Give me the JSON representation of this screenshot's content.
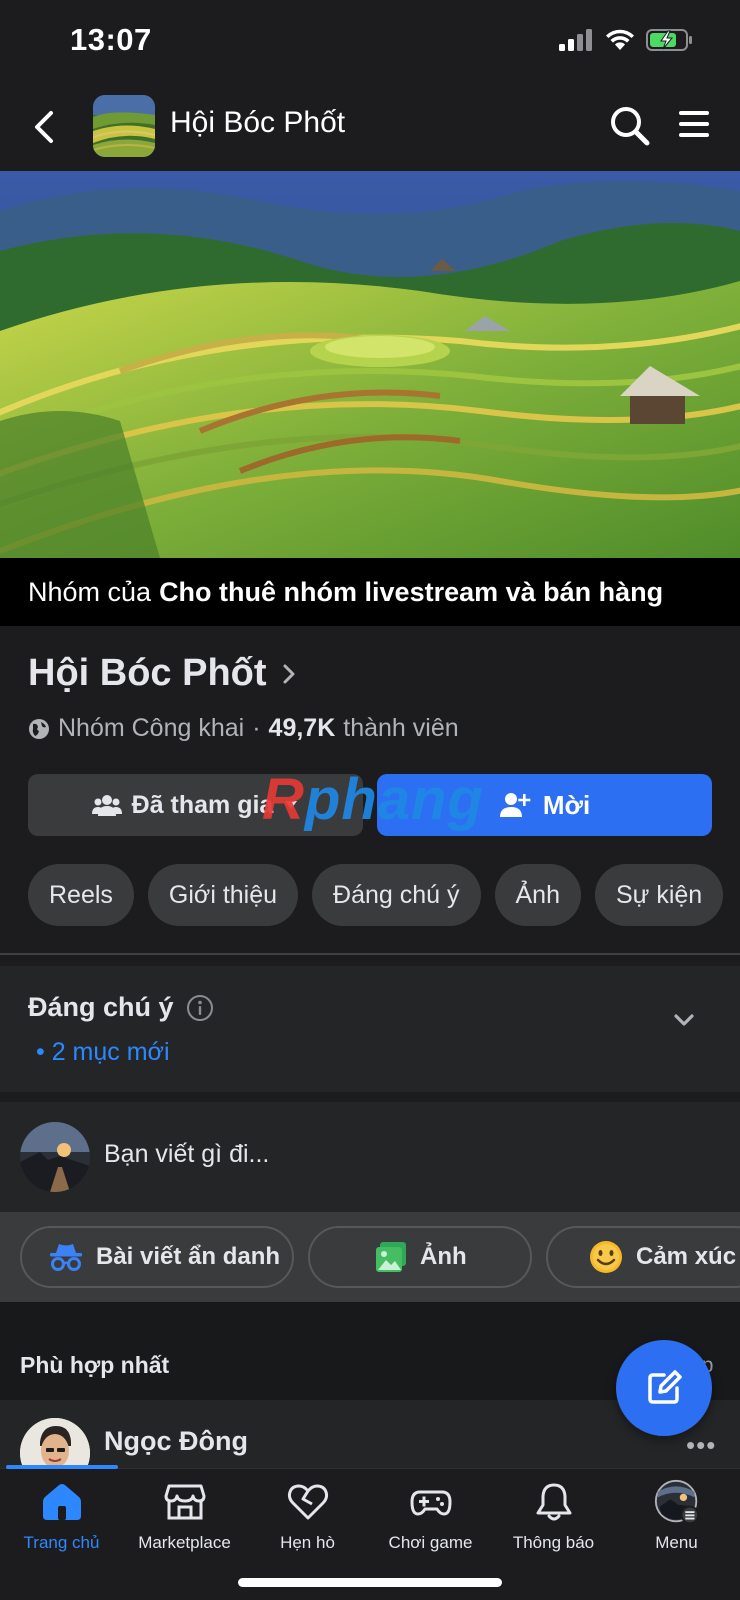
{
  "status_bar": {
    "time": "13:07"
  },
  "header": {
    "title": "Hội Bóc Phốt"
  },
  "owner_bar": {
    "prefix": "Nhóm của",
    "owner": "Cho thuê nhóm livestream và bán hàng"
  },
  "group": {
    "name": "Hội Bóc Phốt",
    "privacy": "Nhóm Công khai",
    "separator": "·",
    "member_count": "49,7K",
    "member_label": "thành viên"
  },
  "buttons": {
    "joined": "Đã tham gia",
    "invite": "Mời"
  },
  "watermark": {
    "first": "R",
    "rest": "phang"
  },
  "tabs": [
    "Reels",
    "Giới thiệu",
    "Đáng chú ý",
    "Ảnh",
    "Sự kiện"
  ],
  "highlight": {
    "title": "Đáng chú ý",
    "subtitle": "• 2 mục mới"
  },
  "composer": {
    "placeholder": "Bạn viết gì đi..."
  },
  "actions": {
    "anonymous": "Bài viết ẩn danh",
    "photo": "Ảnh",
    "feeling": "Cảm xúc"
  },
  "feed": {
    "sort_label": "Phù hợp nhất",
    "sort_right": "ớp"
  },
  "post": {
    "author": "Ngọc Đông",
    "more": "•••"
  },
  "tabbar": {
    "home": "Trang chủ",
    "marketplace": "Marketplace",
    "dating": "Hẹn hò",
    "gaming": "Chơi game",
    "notifications": "Thông báo",
    "menu": "Menu"
  },
  "colors": {
    "accent": "#2d6ff2",
    "link": "#2d88ff",
    "background": "#1c1c1e"
  }
}
